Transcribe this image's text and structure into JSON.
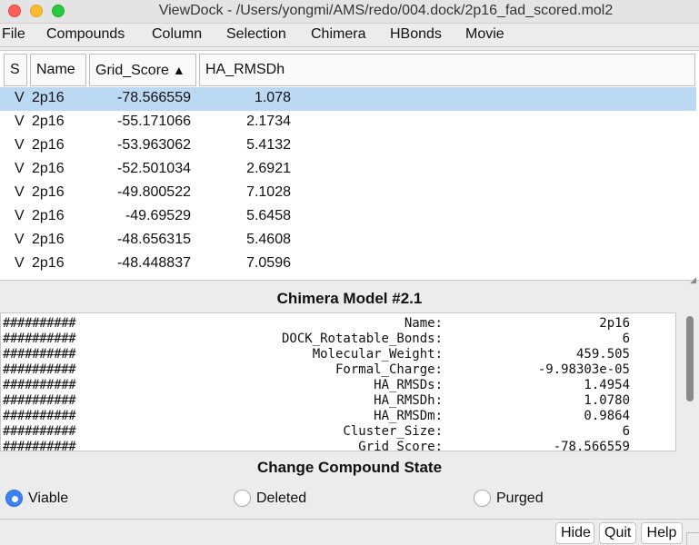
{
  "window": {
    "title": "ViewDock - /Users/yongmi/AMS/redo/004.dock/2p16_fad_scored.mol2"
  },
  "menu": [
    "File",
    "Compounds",
    "Column",
    "Selection",
    "Chimera",
    "HBonds",
    "Movie"
  ],
  "table": {
    "headers": {
      "s": "S",
      "name": "Name",
      "grid": "Grid_Score",
      "sort_arrow": "▲",
      "ha": "HA_RMSDh"
    },
    "rows": [
      {
        "s": "V",
        "name": "2p16",
        "grid": "-78.566559",
        "ha": "1.078",
        "selected": true
      },
      {
        "s": "V",
        "name": "2p16",
        "grid": "-55.171066",
        "ha": "2.1734"
      },
      {
        "s": "V",
        "name": "2p16",
        "grid": "-53.963062",
        "ha": "5.4132"
      },
      {
        "s": "V",
        "name": "2p16",
        "grid": "-52.501034",
        "ha": "2.6921"
      },
      {
        "s": "V",
        "name": "2p16",
        "grid": "-49.800522",
        "ha": "7.1028"
      },
      {
        "s": "V",
        "name": "2p16",
        "grid": "-49.69529",
        "ha": "5.6458"
      },
      {
        "s": "V",
        "name": "2p16",
        "grid": "-48.656315",
        "ha": "5.4608"
      },
      {
        "s": "V",
        "name": "2p16",
        "grid": "-48.448837",
        "ha": "7.0596"
      }
    ]
  },
  "model_title": "Chimera Model #2.1",
  "info": {
    "hash": "##########",
    "lines": [
      {
        "key": "Name:",
        "value": "2p16"
      },
      {
        "key": "DOCK_Rotatable_Bonds:",
        "value": "6"
      },
      {
        "key": "Molecular_Weight:",
        "value": "459.505"
      },
      {
        "key": "Formal_Charge:",
        "value": "-9.98303e-05"
      },
      {
        "key": "HA_RMSDs:",
        "value": "1.4954"
      },
      {
        "key": "HA_RMSDh:",
        "value": "1.0780"
      },
      {
        "key": "HA_RMSDm:",
        "value": "0.9864"
      },
      {
        "key": "Cluster_Size:",
        "value": "6"
      },
      {
        "key": "Grid_Score:",
        "value": "-78.566559"
      }
    ]
  },
  "state": {
    "title": "Change Compound State",
    "options": [
      {
        "label": "Viable",
        "checked": true
      },
      {
        "label": "Deleted",
        "checked": false
      },
      {
        "label": "Purged",
        "checked": false
      }
    ]
  },
  "buttons": {
    "hide": "Hide",
    "quit": "Quit",
    "help": "Help"
  },
  "colors": {
    "selection": "#bcd9f4",
    "radio_on": "#3b82f6"
  }
}
